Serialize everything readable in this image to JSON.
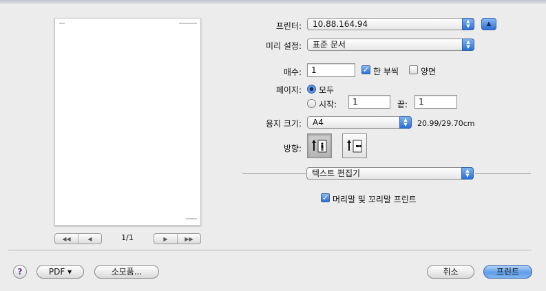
{
  "preview": {
    "page_indicator": "1/1",
    "nav_first": "◀◀",
    "nav_prev": "◀",
    "nav_next": "▶",
    "nav_last": "▶▶"
  },
  "printer": {
    "label": "프린터:",
    "value": "10.88.164.94"
  },
  "presets": {
    "label": "미리 설정:",
    "value": "표준 문서"
  },
  "copies": {
    "label": "매수:",
    "value": "1",
    "collated_label": "한 부씩",
    "collated_checked": true,
    "duplex_label": "양면",
    "duplex_checked": false
  },
  "pages": {
    "label": "페이지:",
    "all_label": "모두",
    "from_label": "시작:",
    "from_value": "1",
    "to_label": "끝:",
    "to_value": "1",
    "selected": "all"
  },
  "paper_size": {
    "label": "용지 크기:",
    "value": "A4",
    "dimensions": "20.99/29.70cm"
  },
  "orientation": {
    "label": "방향:",
    "selected": "portrait"
  },
  "section": {
    "value": "텍스트 편집기"
  },
  "header_footer": {
    "label": "머리말 및 꼬리말 프린트",
    "checked": true
  },
  "buttons": {
    "help": "?",
    "pdf": "PDF ▾",
    "supplies": "소모품...",
    "cancel": "취소",
    "print": "프린트"
  },
  "colors": {
    "accent": "#2a6fd6",
    "background": "#ececec"
  },
  "icons": {
    "popup_arrows": "updown-chevron-icon",
    "disclosure": "up-triangle-icon",
    "orientation_portrait": "portrait-orientation-icon",
    "orientation_landscape": "landscape-orientation-icon"
  }
}
